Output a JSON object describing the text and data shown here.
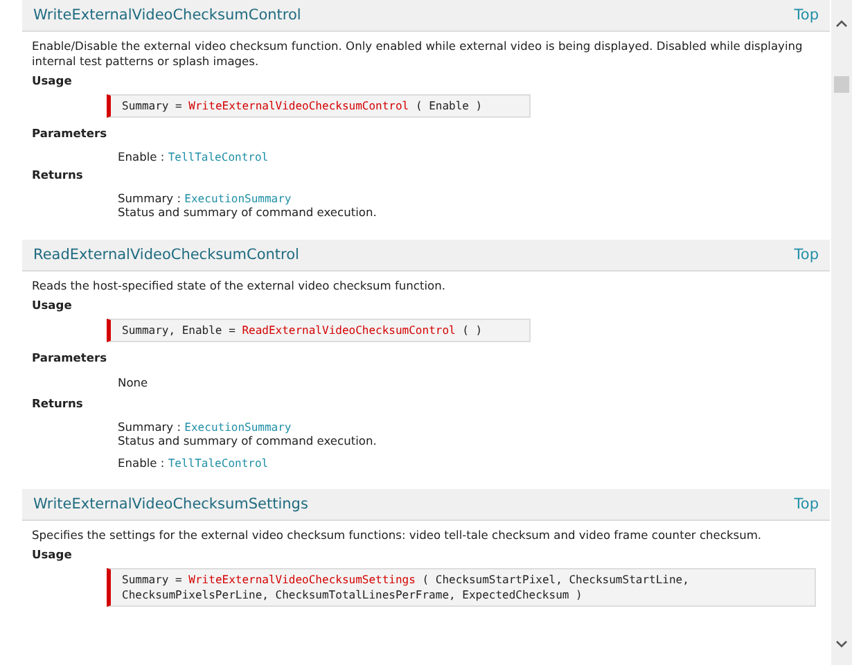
{
  "sections": [
    {
      "title": "WriteExternalVideoChecksumControl",
      "top_link": "Top",
      "description": "Enable/Disable the external video checksum function. Only enabled while external video is being displayed. Disabled while displaying internal test patterns or splash images.",
      "usage_label": "Usage",
      "usage": {
        "before": "Summary = ",
        "function": "WriteExternalVideoChecksumControl",
        "after": " ( Enable )"
      },
      "parameters_label": "Parameters",
      "parameters": [
        {
          "name": "Enable :",
          "type": "TellTaleControl"
        }
      ],
      "returns_label": "Returns",
      "returns": [
        {
          "name": "Summary :",
          "type": "ExecutionSummary",
          "description": "Status and summary of command execution."
        }
      ]
    },
    {
      "title": "ReadExternalVideoChecksumControl",
      "top_link": "Top",
      "description": "Reads the host-specified state of the external video checksum function.",
      "usage_label": "Usage",
      "usage": {
        "before": "Summary, Enable = ",
        "function": "ReadExternalVideoChecksumControl",
        "after": " ( )"
      },
      "parameters_label": "Parameters",
      "parameters_none": "None",
      "returns_label": "Returns",
      "returns": [
        {
          "name": "Summary :",
          "type": "ExecutionSummary",
          "description": "Status and summary of command execution."
        },
        {
          "name": "Enable :",
          "type": "TellTaleControl"
        }
      ]
    },
    {
      "title": "WriteExternalVideoChecksumSettings",
      "top_link": "Top",
      "description": "Specifies the settings for the external video checksum functions: video tell-tale checksum and video frame counter checksum.",
      "usage_label": "Usage",
      "usage": {
        "before": "Summary = ",
        "function": "WriteExternalVideoChecksumSettings",
        "after": " ( ChecksumStartPixel, ChecksumStartLine, ChecksumPixelsPerLine, ChecksumTotalLinesPerFrame, ExpectedChecksum )"
      }
    }
  ]
}
